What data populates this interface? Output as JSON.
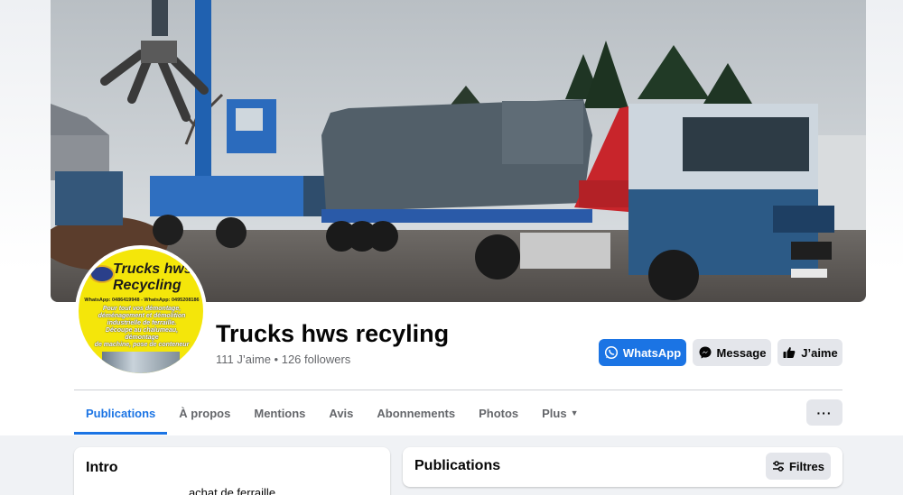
{
  "avatar": {
    "title_line1": "Trucks hws",
    "title_line2": "Recycling",
    "contacts": "WhatsApp: 0486419948 - WhatsApp: 0495208186",
    "lines": [
      "Pour tout vos démontage,",
      "déménagement et démolition",
      "industrielle de ferraille.",
      "Découpe au chalumeau, démontage",
      "de machine, pose de conteneur"
    ]
  },
  "page": {
    "name": "Trucks hws recyling",
    "stats": "111 J’aime • 126 followers"
  },
  "actions": {
    "whatsapp": "WhatsApp",
    "message": "Message",
    "like": "J’aime",
    "more": "···"
  },
  "tabs": [
    {
      "label": "Publications",
      "active": true
    },
    {
      "label": "À propos"
    },
    {
      "label": "Mentions"
    },
    {
      "label": "Avis"
    },
    {
      "label": "Abonnements"
    },
    {
      "label": "Photos"
    },
    {
      "label": "Plus"
    }
  ],
  "intro": {
    "title": "Intro",
    "text": "achat de ferraille"
  },
  "publications": {
    "title": "Publications",
    "filter": "Filtres"
  },
  "colors": {
    "accent": "#1b74e4",
    "avatar_bg": "#f4e60a"
  },
  "icons": {
    "whatsapp": "whatsapp-icon",
    "message": "messenger-icon",
    "like": "thumbs-up-icon",
    "filter": "sliders-icon",
    "more_caret": "caret-down-icon"
  }
}
